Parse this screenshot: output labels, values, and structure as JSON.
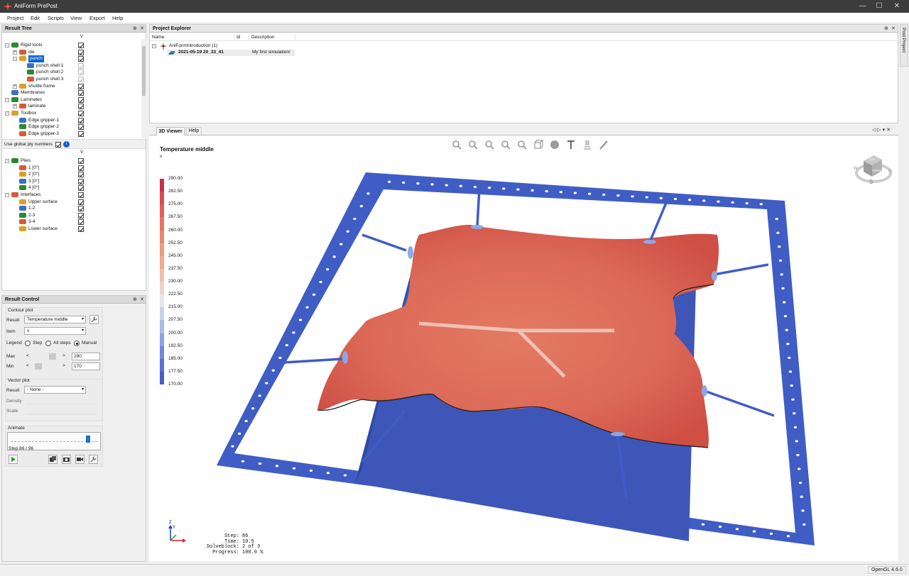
{
  "window": {
    "title": "AniForm PrePost",
    "minimize": "—",
    "maximize": "☐",
    "close": "✕"
  },
  "menu": [
    "Project",
    "Edit",
    "Scripts",
    "View",
    "Export",
    "Help"
  ],
  "result_tree": {
    "title": "Result Tree",
    "pin": "⊕",
    "close": "✕",
    "col_v": "V",
    "rows": [
      {
        "label": "Rigid tools",
        "level": 0,
        "exp": "⊟",
        "checked": true
      },
      {
        "label": "die",
        "level": 1,
        "exp": "⊞",
        "checked": true
      },
      {
        "label": "punch",
        "level": 1,
        "exp": "⊟",
        "checked": true,
        "selected": true
      },
      {
        "label": "punch shell 1",
        "level": 2,
        "checked": true,
        "disabled": true
      },
      {
        "label": "punch shell 2",
        "level": 2,
        "checked": true,
        "disabled": true
      },
      {
        "label": "punch shell 3",
        "level": 2,
        "checked": true,
        "disabled": true
      },
      {
        "label": "shuttle frame",
        "level": 1,
        "exp": "⊞",
        "checked": true
      },
      {
        "label": "Membranes",
        "level": 0,
        "checked": true
      },
      {
        "label": "Laminates",
        "level": 0,
        "exp": "⊟",
        "checked": true
      },
      {
        "label": "laminate",
        "level": 1,
        "exp": "⊞",
        "checked": true
      },
      {
        "label": "Toolbox",
        "level": 0,
        "exp": "⊟",
        "checked": true
      },
      {
        "label": "Edge gripper-1",
        "level": 1,
        "checked": true
      },
      {
        "label": "Edge gripper-2",
        "level": 1,
        "checked": true
      },
      {
        "label": "Edge gripper-3",
        "level": 1,
        "checked": true
      }
    ],
    "global_ply_label": "Use global ply numbers",
    "info": "i",
    "col_v2": "V",
    "ply_rows": [
      {
        "label": "Plies",
        "level": 0,
        "exp": "⊟",
        "checked": true
      },
      {
        "label": "1 [0°]",
        "level": 1,
        "checked": true
      },
      {
        "label": "2 [0°]",
        "level": 1,
        "checked": true
      },
      {
        "label": "3 [0°]",
        "level": 1,
        "checked": true
      },
      {
        "label": "4 [0°]",
        "level": 1,
        "checked": true
      },
      {
        "label": "Interfaces",
        "level": 0,
        "exp": "⊟",
        "checked": true
      },
      {
        "label": "Upper surface",
        "level": 1,
        "checked": true
      },
      {
        "label": "1-2",
        "level": 1,
        "checked": true
      },
      {
        "label": "2-3",
        "level": 1,
        "checked": true
      },
      {
        "label": "3-4",
        "level": 1,
        "checked": true
      },
      {
        "label": "Lower surface",
        "level": 1,
        "checked": true
      }
    ]
  },
  "result_control": {
    "title": "Result Control",
    "pin": "⊕",
    "close": "✕",
    "contour_title": "Contour plot",
    "result_label": "Result",
    "result_value": "Temperature middle",
    "item_label": "Item",
    "item_value": "s",
    "legend_label": "Legend",
    "legend_options": [
      "Step",
      "All steps",
      "Manual"
    ],
    "legend_selected": 2,
    "max_label": "Max",
    "max_value": "290",
    "min_label": "Min",
    "min_value": "170",
    "arrow_left": "<",
    "arrow_right": ">",
    "vector_title": "Vector plot",
    "vector_result_label": "Result",
    "vector_result_value": "- None -",
    "density_label": "Density",
    "scale_label": "Scale",
    "animate_title": "Animate",
    "step_text": "Step 86 / 96",
    "step_fraction": 0.895
  },
  "project_explorer": {
    "title": "Project Explorer",
    "pin": "⊕",
    "close": "✕",
    "cols": [
      "Name",
      "Id",
      "Description"
    ],
    "root": "AniFormIntroduction (1)",
    "child": {
      "name": "2021-05-19 20_33_41",
      "desc": "My first simulation!"
    },
    "side_tab": "Post Project"
  },
  "viewer": {
    "tabs": [
      "3D Viewer",
      "Help"
    ],
    "tab_controls": "◁ ▷ ▾ ✕",
    "contour_title": "Temperature middle",
    "contour_item": "s",
    "legend_values": [
      "290.00",
      "282.50",
      "275.00",
      "267.50",
      "260.00",
      "252.50",
      "245.00",
      "237.50",
      "230.00",
      "222.50",
      "215.00",
      "207.50",
      "200.00",
      "192.50",
      "185.00",
      "177.50",
      "170.00"
    ],
    "legend_colors": [
      "#c8304a",
      "#d94c52",
      "#e1605a",
      "#e57664",
      "#e8896f",
      "#eb9c7c",
      "#ecad8f",
      "#eec0a8",
      "#f0d3c6",
      "#e6e6f0",
      "#c8d2ee",
      "#a9bcea",
      "#8ba3e4",
      "#6f8ad9",
      "#5773cf",
      "#4660c4"
    ],
    "info": {
      "step_label": "Step:",
      "step": "86",
      "time_label": "Time:",
      "time": "10.5",
      "block_label": "Solveblock:",
      "block": "2 of 3",
      "progress_label": "Progress:",
      "progress": "100.0 %"
    },
    "cube": {
      "face": "FRONT",
      "top": "TOP",
      "w": "W",
      "e": "E",
      "s": "S"
    },
    "axis": {
      "y": "Y",
      "z": "Z"
    },
    "toolbar_icons": [
      "zoom-box-icon",
      "zoom-icon",
      "pan-icon",
      "rotate-icon",
      "fit-icon",
      "box-view-icon",
      "sphere-icon",
      "text-icon",
      "section-icon",
      "pencil-icon"
    ],
    "colors": {
      "frame": "#3f5dc4",
      "laminate": "#e0705c",
      "die": "#3d56b8",
      "bg": "#ffffff"
    }
  },
  "status": {
    "opengl": "OpenGL 4.6.0"
  }
}
